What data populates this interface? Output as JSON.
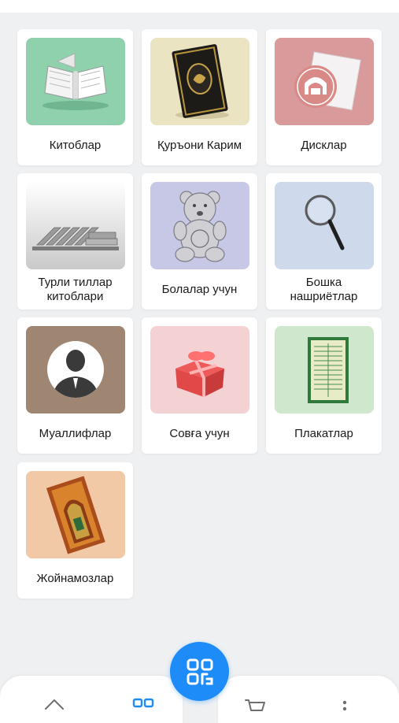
{
  "categories": [
    {
      "label": "Китоблар",
      "icon": "open-book-icon"
    },
    {
      "label": "Қуръони Карим",
      "icon": "quran-icon"
    },
    {
      "label": "Дисклар",
      "icon": "disc-icon"
    },
    {
      "label": "Турли тиллар китоблари",
      "icon": "book-stack-icon"
    },
    {
      "label": "Болалар учун",
      "icon": "teddy-bear-icon"
    },
    {
      "label": "Бошка нашриётлар",
      "icon": "magnifier-icon"
    },
    {
      "label": "Муаллифлар",
      "icon": "person-icon"
    },
    {
      "label": "Совға учун",
      "icon": "gift-icon"
    },
    {
      "label": "Плакатлар",
      "icon": "poster-icon"
    },
    {
      "label": "Жойнамозлар",
      "icon": "prayer-rug-icon"
    }
  ],
  "bottom_nav": {
    "items": [
      "home-icon",
      "catalog-icon",
      "cart-icon",
      "more-icon"
    ],
    "fab_icon": "qr-code-icon",
    "accent_color": "#1d8cf8"
  }
}
